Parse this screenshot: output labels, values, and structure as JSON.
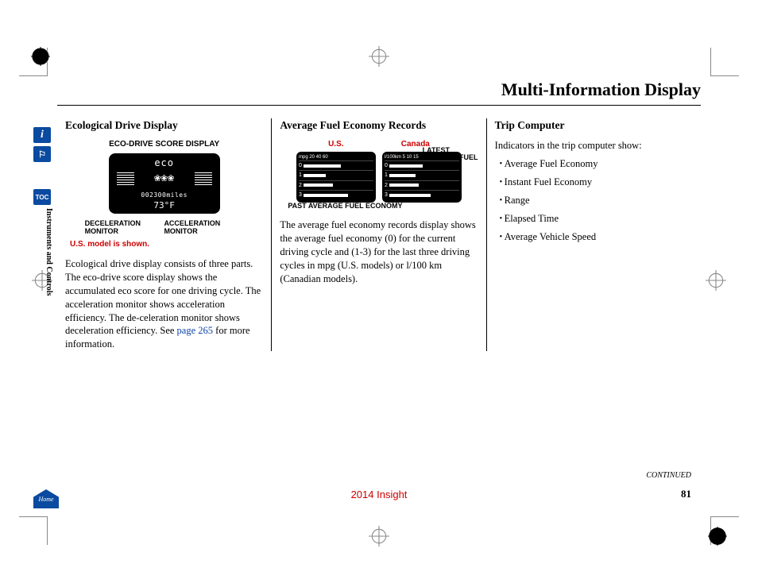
{
  "page_title": "Multi-Information Display",
  "section_label": "Instruments and Controls",
  "side_tabs": {
    "info": "i",
    "car": "⛟",
    "toc": "TOC",
    "home": "Home"
  },
  "col1": {
    "heading": "Ecological Drive Display",
    "fig_title": "ECO-DRIVE SCORE DISPLAY",
    "screen": {
      "eco": "eco",
      "odometer_value": "002300",
      "odometer_unit": "miles",
      "temp": "73°F"
    },
    "label_decel": "DECELERATION MONITOR",
    "label_accel": "ACCELERATION MONITOR",
    "note": "U.S. model is shown.",
    "body_a": "Ecological drive display consists of three parts. The eco-drive score display shows the accumulated eco score for one driving cycle. The  acceleration monitor shows acceleration efficiency. The de-celeration monitor shows  deceleration efficiency. See ",
    "link": "page  265",
    "body_b": "  for  more information."
  },
  "col2": {
    "heading": "Average Fuel Economy Records",
    "label_us": "U.S.",
    "label_canada": "Canada",
    "label_latest": "LATEST AVERAGE FUEL ECONOMY",
    "label_past": "PAST AVERAGE FUEL ECONOMY",
    "us_scale": "mpg  20 40 60",
    "ca_scale": "l/100km 5 10 15",
    "rows": [
      "0",
      "1",
      "2",
      "3"
    ],
    "body": "The average fuel economy records display shows the average fuel economy (0) for the current driving cycle and (1-3) for the last three driving cycles in mpg (U.S. models) or l/100 km (Canadian models)."
  },
  "col3": {
    "heading": "Trip Computer",
    "intro": "Indicators in the trip computer show:",
    "items": [
      "Average Fuel Economy",
      "Instant Fuel Economy",
      "Range",
      "Elapsed Time",
      "Average Vehicle Speed"
    ]
  },
  "continued": "CONTINUED",
  "footer_model": "2014 Insight",
  "page_number": "81"
}
